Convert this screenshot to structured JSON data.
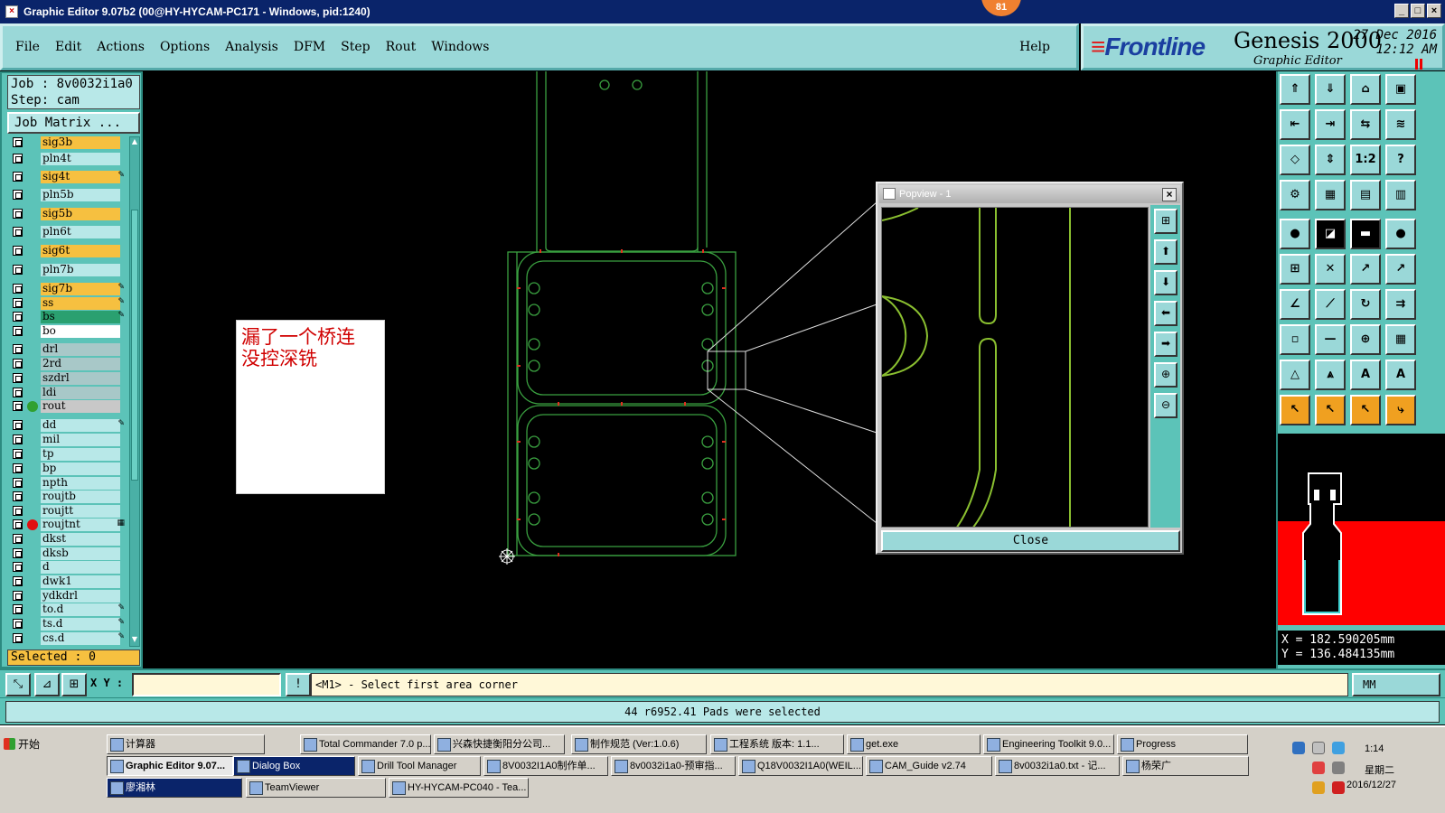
{
  "window": {
    "title": "Graphic Editor 9.07b2 (00@HY-HYCAM-PC171 - Windows, pid:1240)",
    "badge": "81",
    "buttons": [
      "_",
      "□",
      "×"
    ]
  },
  "menu": {
    "items": [
      "File",
      "Edit",
      "Actions",
      "Options",
      "Analysis",
      "DFM",
      "Step",
      "Rout",
      "Windows"
    ],
    "help": "Help"
  },
  "brand": {
    "logo": "Frontline",
    "product": "Genesis 2000",
    "subtitle": "Graphic Editor",
    "date": "27 Dec 2016",
    "time": "12:12 AM"
  },
  "job": {
    "job": "Job : 8v0032i1a0",
    "step": "Step: cam",
    "matrix_button": "Job Matrix ...",
    "selected": "Selected : 0"
  },
  "layers": [
    {
      "name": "sig3b",
      "color": "#f6c040",
      "mark": ""
    },
    {
      "name": "pln4t",
      "color": "#b8e8e8",
      "mark": ""
    },
    {
      "name": "sig4t",
      "color": "#f6c040",
      "mark": "✎"
    },
    {
      "name": "pln5b",
      "color": "#b8e8e8",
      "mark": ""
    },
    {
      "name": "sig5b",
      "color": "#f6c040",
      "mark": ""
    },
    {
      "name": "pln6t",
      "color": "#b8e8e8",
      "mark": ""
    },
    {
      "name": "sig6t",
      "color": "#f6c040",
      "mark": ""
    },
    {
      "name": "pln7b",
      "color": "#b8e8e8",
      "mark": ""
    },
    {
      "name": "sig7b",
      "color": "#f6c040",
      "mark": "✎"
    },
    {
      "name": "ss",
      "color": "#f6c040",
      "mark": "✎"
    },
    {
      "name": "bs",
      "color": "#2aa070",
      "mark": "✎"
    },
    {
      "name": "bo",
      "color": "#ffffff",
      "mark": ""
    },
    {
      "name": "drl",
      "color": "#a8c8c8",
      "mark": ""
    },
    {
      "name": "2rd",
      "color": "#a8c8c8",
      "mark": ""
    },
    {
      "name": "szdrl",
      "color": "#a8c8c8",
      "mark": ""
    },
    {
      "name": "ldi",
      "color": "#a8c8c8",
      "mark": ""
    },
    {
      "name": "rout",
      "color": "#c8c8c8",
      "mark": "",
      "dot": "#30a030"
    },
    {
      "name": "dd",
      "color": "#b8e8e8",
      "mark": "✎"
    },
    {
      "name": "mil",
      "color": "#b8e8e8",
      "mark": ""
    },
    {
      "name": "tp",
      "color": "#b8e8e8",
      "mark": ""
    },
    {
      "name": "bp",
      "color": "#b8e8e8",
      "mark": ""
    },
    {
      "name": "npth",
      "color": "#b8e8e8",
      "mark": ""
    },
    {
      "name": "roujtb",
      "color": "#b8e8e8",
      "mark": ""
    },
    {
      "name": "roujtt",
      "color": "#b8e8e8",
      "mark": ""
    },
    {
      "name": "roujtnt",
      "color": "#b8e8e8",
      "mark": "▦",
      "dot": "#e01010"
    },
    {
      "name": "dkst",
      "color": "#b8e8e8",
      "mark": ""
    },
    {
      "name": "dksb",
      "color": "#b8e8e8",
      "mark": ""
    },
    {
      "name": "d",
      "color": "#b8e8e8",
      "mark": ""
    },
    {
      "name": "dwk1",
      "color": "#b8e8e8",
      "mark": ""
    },
    {
      "name": "ydkdrl",
      "color": "#b8e8e8",
      "mark": ""
    },
    {
      "name": "to.d",
      "color": "#b8e8e8",
      "mark": "✎"
    },
    {
      "name": "ts.d",
      "color": "#b8e8e8",
      "mark": "✎"
    },
    {
      "name": "cs.d",
      "color": "#b8e8e8",
      "mark": "✎"
    }
  ],
  "note": {
    "line1": "漏了一个桥连",
    "line2": "没控深铣"
  },
  "popview": {
    "title": "Popview - 1",
    "close": "Close"
  },
  "coords": {
    "x": "X = 182.590205mm",
    "y": "Y = 136.484135mm"
  },
  "command": {
    "xy_label": "X Y :",
    "input_value": "",
    "prompt": "<M1> - Select first area corner",
    "unit": "MM"
  },
  "status": {
    "message": "44 r6952.41 Pads were selected"
  },
  "taskbar": {
    "start": "开始",
    "row1": [
      "计算器",
      "Total Commander 7.0 p...",
      "兴森快捷衡阳分公司...",
      "制作规范 (Ver:1.0.6)",
      "工程系统  版本: 1.1...",
      "get.exe",
      "Engineering Toolkit 9.0...",
      "Progress"
    ],
    "row2": [
      "Graphic Editor 9.07...",
      "Dialog Box",
      "Drill Tool Manager",
      "8V0032I1A0制作单...",
      "8v0032i1a0-预审指...",
      "Q18V0032I1A0(WEIL...",
      "CAM_Guide v2.74",
      "8v0032i1a0.txt - 记...",
      "杨荣广"
    ],
    "row3": [
      "廖湘林",
      "TeamViewer",
      "HY-HYCAM-PC040 - Tea..."
    ],
    "clock_time": "1:14",
    "clock_day": "星期二",
    "clock_date": "2016/12/27"
  },
  "colors": {
    "teal": "#5cc3b8",
    "light_teal": "#9ad8d8",
    "board_outline": "#3aa040",
    "highlight_red": "#ff0000"
  }
}
